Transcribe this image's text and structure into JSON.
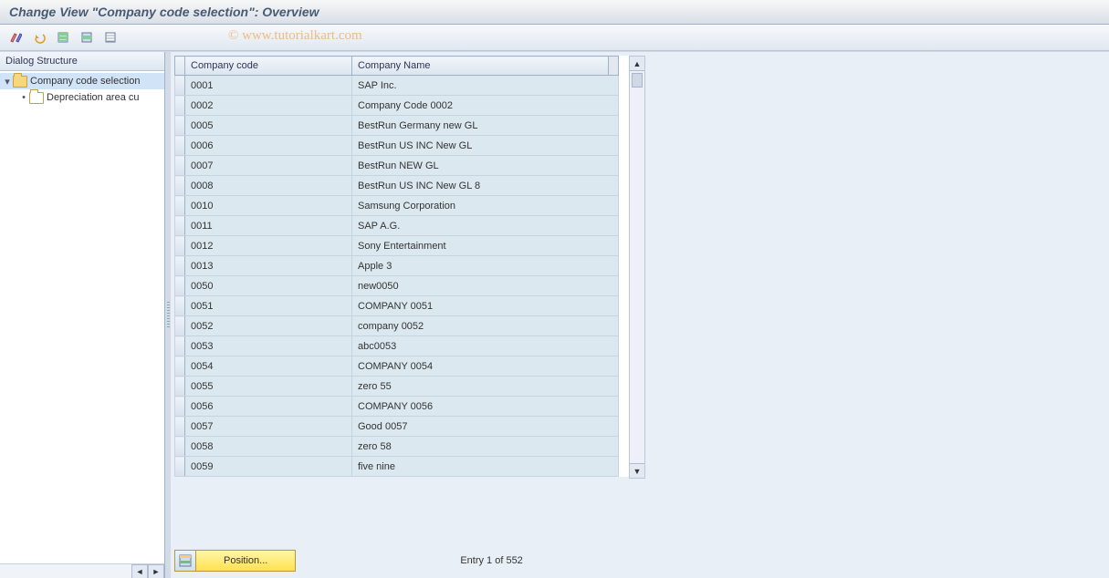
{
  "title": "Change View \"Company code selection\": Overview",
  "watermark": "© www.tutorialkart.com",
  "toolbar": {
    "icons": [
      "toggle-display-change",
      "undo",
      "select-all",
      "select-block",
      "deselect-all"
    ]
  },
  "tree": {
    "header": "Dialog Structure",
    "items": [
      {
        "label": "Company code selection",
        "open": true,
        "selected": true,
        "level": 0
      },
      {
        "label": "Depreciation area cu",
        "open": false,
        "selected": false,
        "level": 1
      }
    ]
  },
  "table": {
    "headers": [
      "Company code",
      "Company Name"
    ],
    "rows": [
      {
        "code": "0001",
        "name": "SAP Inc."
      },
      {
        "code": "0002",
        "name": "Company Code 0002"
      },
      {
        "code": "0005",
        "name": "BestRun Germany new GL"
      },
      {
        "code": "0006",
        "name": "BestRun US INC New GL"
      },
      {
        "code": "0007",
        "name": "BestRun NEW GL"
      },
      {
        "code": "0008",
        "name": "BestRun US INC New GL 8"
      },
      {
        "code": "0010",
        "name": "Samsung Corporation"
      },
      {
        "code": "0011",
        "name": "SAP A.G."
      },
      {
        "code": "0012",
        "name": "Sony Entertainment"
      },
      {
        "code": "0013",
        "name": "Apple 3"
      },
      {
        "code": "0050",
        "name": "new0050"
      },
      {
        "code": "0051",
        "name": "COMPANY 0051"
      },
      {
        "code": "0052",
        "name": "company 0052"
      },
      {
        "code": "0053",
        "name": "abc0053"
      },
      {
        "code": "0054",
        "name": "COMPANY 0054"
      },
      {
        "code": "0055",
        "name": "zero 55"
      },
      {
        "code": "0056",
        "name": "COMPANY 0056"
      },
      {
        "code": "0057",
        "name": "Good 0057"
      },
      {
        "code": "0058",
        "name": "zero 58"
      },
      {
        "code": "0059",
        "name": "five nine"
      }
    ]
  },
  "footer": {
    "position_label": "Position...",
    "entry_text": "Entry 1 of 552"
  }
}
